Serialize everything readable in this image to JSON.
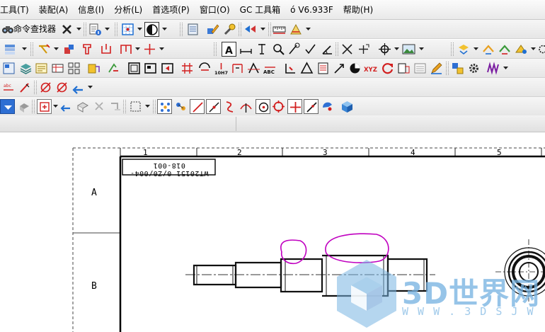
{
  "menubar": {
    "items": [
      "工具(T)",
      "装配(A)",
      "信息(I)",
      "分析(L)",
      "首选项(P)",
      "窗口(O)",
      "GC 工具箱",
      "ó V6.933F",
      "帮助(H)"
    ]
  },
  "toolbar": {
    "command_finder_label": "命令查找器"
  },
  "icons": {
    "row1": [
      "binoculars-icon",
      "close-icon",
      "info-icon",
      "grid-icon",
      "shade-icon",
      "database-icon",
      "edit-icon",
      "tools-icon",
      "view-icon",
      "measure-icon",
      "section-icon"
    ],
    "row2": [
      "layer-icon",
      "constraint-icon",
      "component-icon",
      "gear-icon",
      "text-icon",
      "dimension-icon",
      "zoom-icon",
      "angle-icon",
      "crosshair-icon",
      "image-icon"
    ],
    "row3": [
      "template-icon",
      "stack-icon",
      "frame-icon",
      "move-icon",
      "cut-icon",
      "arrow-icon",
      "fit-icon",
      "refresh-icon",
      "xyz-icon",
      "redo-icon"
    ],
    "row4": [
      "insert-icon",
      "pencil-icon",
      "diameter-icon",
      "diameter-icon",
      "undo-icon"
    ],
    "row5": [
      "snap-point-icon",
      "line-icon",
      "midpoint-icon",
      "intersection-icon",
      "arc-center-icon",
      "circle-icon",
      "cube-icon"
    ]
  },
  "drawing": {
    "zone_columns": [
      "1",
      "2",
      "3",
      "4",
      "5"
    ],
    "zone_rows": [
      "A",
      "B"
    ],
    "part_number": "WT20151 0/Z0/004-018-001"
  },
  "watermark": {
    "title": "3D世界网",
    "url": "W W W . 3 D S J W . C O M"
  },
  "colors": {
    "markup": "#c000c0",
    "watermark": "#78b4e1",
    "toolbar_bg": "#ececec"
  }
}
